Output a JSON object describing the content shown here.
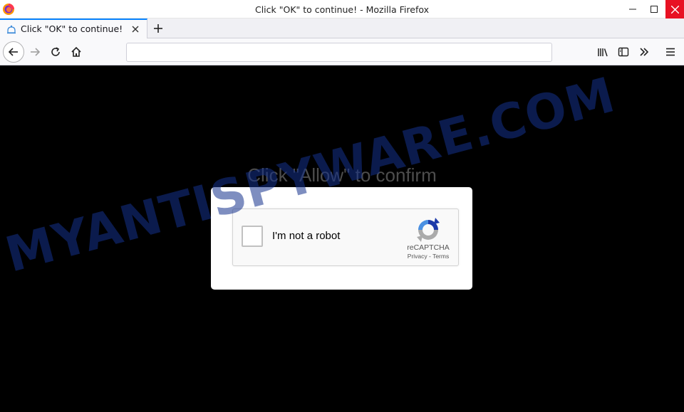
{
  "window": {
    "title": "Click \"OK\" to continue! - Mozilla Firefox"
  },
  "tabs": [
    {
      "title": "Click \"OK\" to continue!",
      "active": true
    }
  ],
  "urlbar": {
    "value": ""
  },
  "page": {
    "headline": "Click \"Allow\" to confirm",
    "captcha": {
      "checkbox_label": "I'm not a robot",
      "brand": "reCAPTCHA",
      "privacy": "Privacy",
      "separator": " - ",
      "terms": "Terms"
    }
  },
  "watermark": "MYANTISPYWARE.COM",
  "colors": {
    "tab_accent": "#0a84ff",
    "close_button": "#e81123",
    "page_background": "#000000",
    "watermark": "#14328c"
  },
  "icons": [
    "firefox-icon",
    "minimize-icon",
    "maximize-icon",
    "close-icon",
    "tab-favicon-icon",
    "tab-close-icon",
    "new-tab-icon",
    "back-icon",
    "forward-icon",
    "reload-icon",
    "home-icon",
    "library-icon",
    "sidebar-icon",
    "overflow-icon",
    "hamburger-menu-icon",
    "recaptcha-logo-icon"
  ]
}
